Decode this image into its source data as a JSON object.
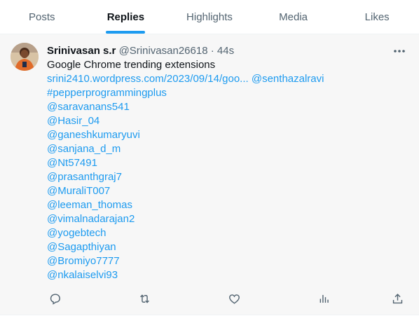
{
  "tabs": [
    {
      "label": "Posts"
    },
    {
      "label": "Replies"
    },
    {
      "label": "Highlights"
    },
    {
      "label": "Media"
    },
    {
      "label": "Likes"
    }
  ],
  "active_tab": "Replies",
  "tweet": {
    "author_name": "Srinivasan s.r",
    "handle": "@Srinivasan26618",
    "separator": "·",
    "time": "44s",
    "text_line": "Google Chrome trending extensions",
    "url": "srini2410.wordpress.com/2023/09/14/goo...",
    "first_mention": "@senthazalravi",
    "hashtag": "#pepperprogrammingplus",
    "mentions": [
      "@saravanans541",
      "@Hasir_04",
      "@ganeshkumaryuvi",
      "@sanjana_d_m",
      "@Nt57491",
      "@prasanthgraj7",
      "@MuraliT007",
      "@leeman_thomas",
      "@vimalnadarajan2",
      "@yogebtech",
      "@Sagapthiyan",
      "@Bromiyo7777",
      "@nkalaiselvi93"
    ]
  },
  "actions": {
    "reply_icon": "reply-icon",
    "repost_icon": "repost-icon",
    "like_icon": "like-icon",
    "views_icon": "views-icon",
    "share_icon": "share-icon"
  },
  "colors": {
    "accent": "#1d9bf0",
    "text": "#0f1419",
    "muted": "#536471",
    "tweet_bg": "#f7f7f7"
  }
}
